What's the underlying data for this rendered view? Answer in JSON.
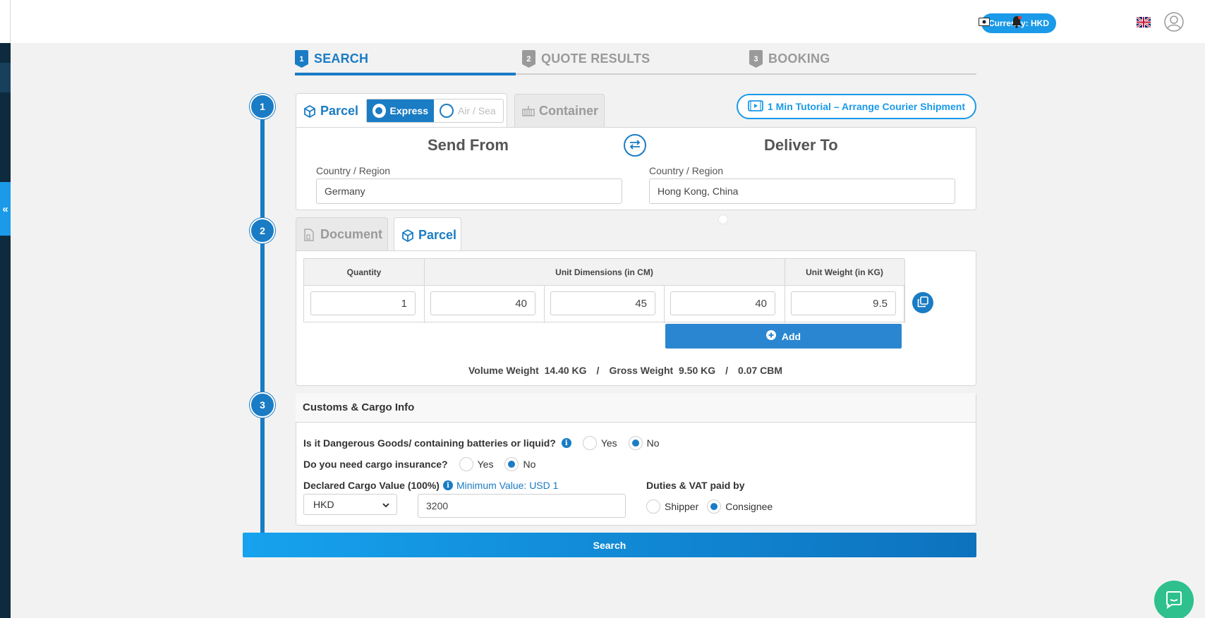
{
  "header": {
    "currency_label": "Currency: HKD"
  },
  "stepper": {
    "steps": [
      {
        "num": "1",
        "label": "SEARCH"
      },
      {
        "num": "2",
        "label": "QUOTE RESULTS"
      },
      {
        "num": "3",
        "label": "BOOKING"
      }
    ],
    "active": 1
  },
  "timeline": {
    "dots": [
      "1",
      "2",
      "3"
    ]
  },
  "shipment_type": {
    "parcel_tab": "Parcel",
    "container_tab": "Container",
    "express_label": "Express",
    "airsea_label": "Air / Sea",
    "selected_mode": "Express"
  },
  "tutorial_button": "1 Min Tutorial – Arrange Courier Shipment",
  "route": {
    "send_from_title": "Send From",
    "deliver_to_title": "Deliver To",
    "from_label": "Country / Region",
    "to_label": "Country / Region",
    "from_value": "Germany",
    "to_value": "Hong Kong, China"
  },
  "package_tabs": {
    "document": "Document",
    "parcel": "Parcel",
    "active": "Parcel"
  },
  "dimensions": {
    "headers": {
      "quantity": "Quantity",
      "dimensions": "Unit Dimensions (in CM)",
      "weight": "Unit Weight (in KG)"
    },
    "row": {
      "quantity": "1",
      "length": "40",
      "width": "45",
      "height": "40",
      "weight": "9.5"
    },
    "add_label": "Add"
  },
  "summary": {
    "volume_label": "Volume Weight",
    "volume_value": "14.40 KG",
    "sep": "/",
    "gross_label": "Gross Weight",
    "gross_value": "9.50 KG",
    "cbm_value": "0.07 CBM"
  },
  "customs": {
    "title": "Customs & Cargo Info",
    "dangerous_q": "Is it Dangerous Goods/ containing batteries or liquid?",
    "insurance_q": "Do you need cargo insurance?",
    "yes": "Yes",
    "no": "No",
    "dangerous_answer": "No",
    "insurance_answer": "No",
    "declared_label": "Declared Cargo Value (100%)",
    "minimum_note": "Minimum Value: USD 1",
    "currency_selected": "HKD",
    "declared_value": "3200",
    "duties_label": "Duties & VAT paid by",
    "shipper": "Shipper",
    "consignee": "Consignee",
    "duties_answer": "Consignee"
  },
  "search_button": "Search",
  "colors": {
    "primary": "#1a7cc4",
    "accent": "#1a9ae8",
    "chat": "#2ec08d",
    "sidebar": "#0d2a3f"
  }
}
